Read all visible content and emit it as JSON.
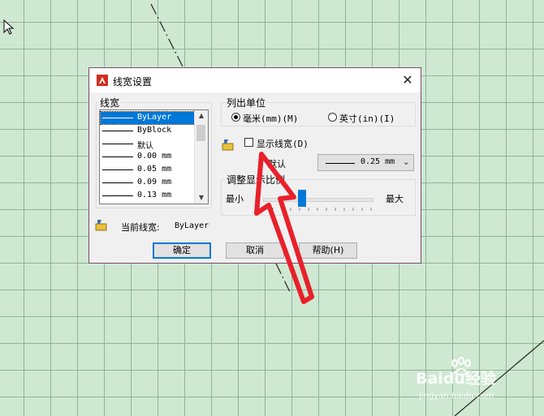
{
  "dialog": {
    "title": "线宽设置",
    "close_label": "✕",
    "lineweight_group_label": "线宽",
    "lineweights": [
      {
        "label": "ByLayer",
        "selected": true
      },
      {
        "label": "ByBlock",
        "selected": false
      },
      {
        "label": "默认",
        "selected": false
      },
      {
        "label": "0.00 mm",
        "selected": false
      },
      {
        "label": "0.05 mm",
        "selected": false
      },
      {
        "label": "0.09 mm",
        "selected": false
      },
      {
        "label": "0.13 mm",
        "selected": false
      }
    ],
    "units_group_label": "列出单位",
    "units_mm_label": "毫米(mm)(M)",
    "units_in_label": "英寸(in)(I)",
    "units_selected": "mm",
    "display_lineweight_label": "显示线宽(D)",
    "display_lineweight_checked": false,
    "default_label": "默认",
    "default_value": "0.25 mm",
    "scale_group_label": "调整显示比例",
    "scale_min_label": "最小",
    "scale_max_label": "最大",
    "scale_fraction": 0.36,
    "current_lineweight_label": "当前线宽:",
    "current_lineweight_value": "ByLayer",
    "ok_label": "确定",
    "cancel_label": "取消",
    "help_label": "帮助(H)"
  },
  "watermark": {
    "brand": "Baidu经验",
    "url": "jingyan.baidu.com"
  },
  "colors": {
    "canvas_background": "#cfe8d2",
    "grid_line": "#8fb598",
    "accent": "#0078d7",
    "annotation_arrow": "#e8202a",
    "app_icon": "#d42b1e"
  }
}
